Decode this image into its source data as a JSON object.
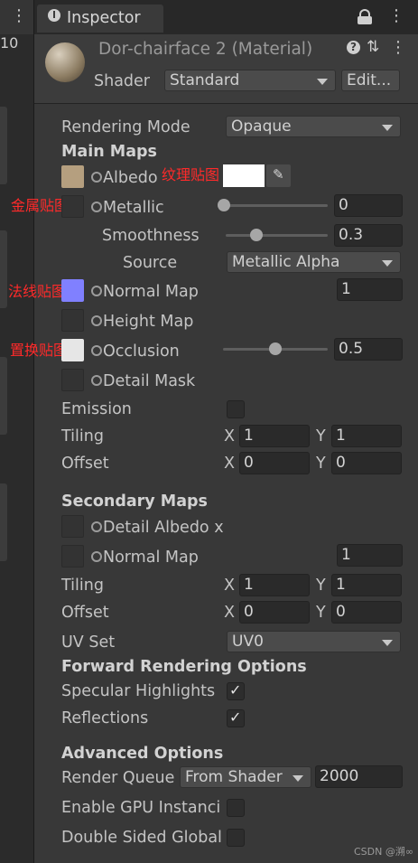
{
  "left_panel": {
    "number": "10"
  },
  "tab": {
    "title": "Inspector"
  },
  "header": {
    "title": "Dor-chairface 2 (Material)",
    "shader_label": "Shader",
    "shader_value": "Standard",
    "edit_label": "Edit..."
  },
  "rendering_mode": {
    "label": "Rendering Mode",
    "value": "Opaque"
  },
  "main_maps": {
    "heading": "Main Maps",
    "albedo_label": "Albedo",
    "metallic_label": "Metallic",
    "metallic_value": "0",
    "metallic_level": 0,
    "smoothness_label": "Smoothness",
    "smoothness_value": "0.3",
    "smoothness_level": 0.3,
    "source_label": "Source",
    "source_value": "Metallic Alpha",
    "normal_label": "Normal Map",
    "normal_value": "1",
    "height_label": "Height Map",
    "occlusion_label": "Occlusion",
    "occlusion_value": "0.5",
    "occlusion_level": 0.5,
    "detail_mask_label": "Detail Mask",
    "emission_label": "Emission",
    "tiling_label": "Tiling",
    "tiling_x": "1",
    "tiling_y": "1",
    "offset_label": "Offset",
    "offset_x": "0",
    "offset_y": "0",
    "x_label": "X",
    "y_label": "Y"
  },
  "secondary_maps": {
    "heading": "Secondary Maps",
    "detail_albedo_label": "Detail Albedo x",
    "normal_label": "Normal Map",
    "normal_value": "1",
    "tiling_label": "Tiling",
    "tiling_x": "1",
    "tiling_y": "1",
    "offset_label": "Offset",
    "offset_x": "0",
    "offset_y": "0",
    "x_label": "X",
    "y_label": "Y",
    "uv_set_label": "UV Set",
    "uv_set_value": "UV0"
  },
  "forward": {
    "heading": "Forward Rendering Options",
    "specular_label": "Specular Highlights",
    "specular_checked": true,
    "reflections_label": "Reflections",
    "reflections_checked": true
  },
  "advanced": {
    "heading": "Advanced Options",
    "render_queue_label": "Render Queue",
    "render_queue_mode": "From Shader",
    "render_queue_value": "2000",
    "gpu_label": "Enable GPU Instanci",
    "double_sided_label": "Double Sided Global"
  },
  "annotations": {
    "albedo": "纹理贴图",
    "metallic": "金属贴图",
    "normal": "法线贴图",
    "occlusion": "置换贴图"
  },
  "watermark": "CSDN @溯∞",
  "colors": {
    "panel_bg": "#383838",
    "albedo_swatch": "#b59f7f",
    "normal_swatch": "#8080ff",
    "occlusion_swatch": "#e6e6e6",
    "annotation_red": "#ff2a2a"
  }
}
